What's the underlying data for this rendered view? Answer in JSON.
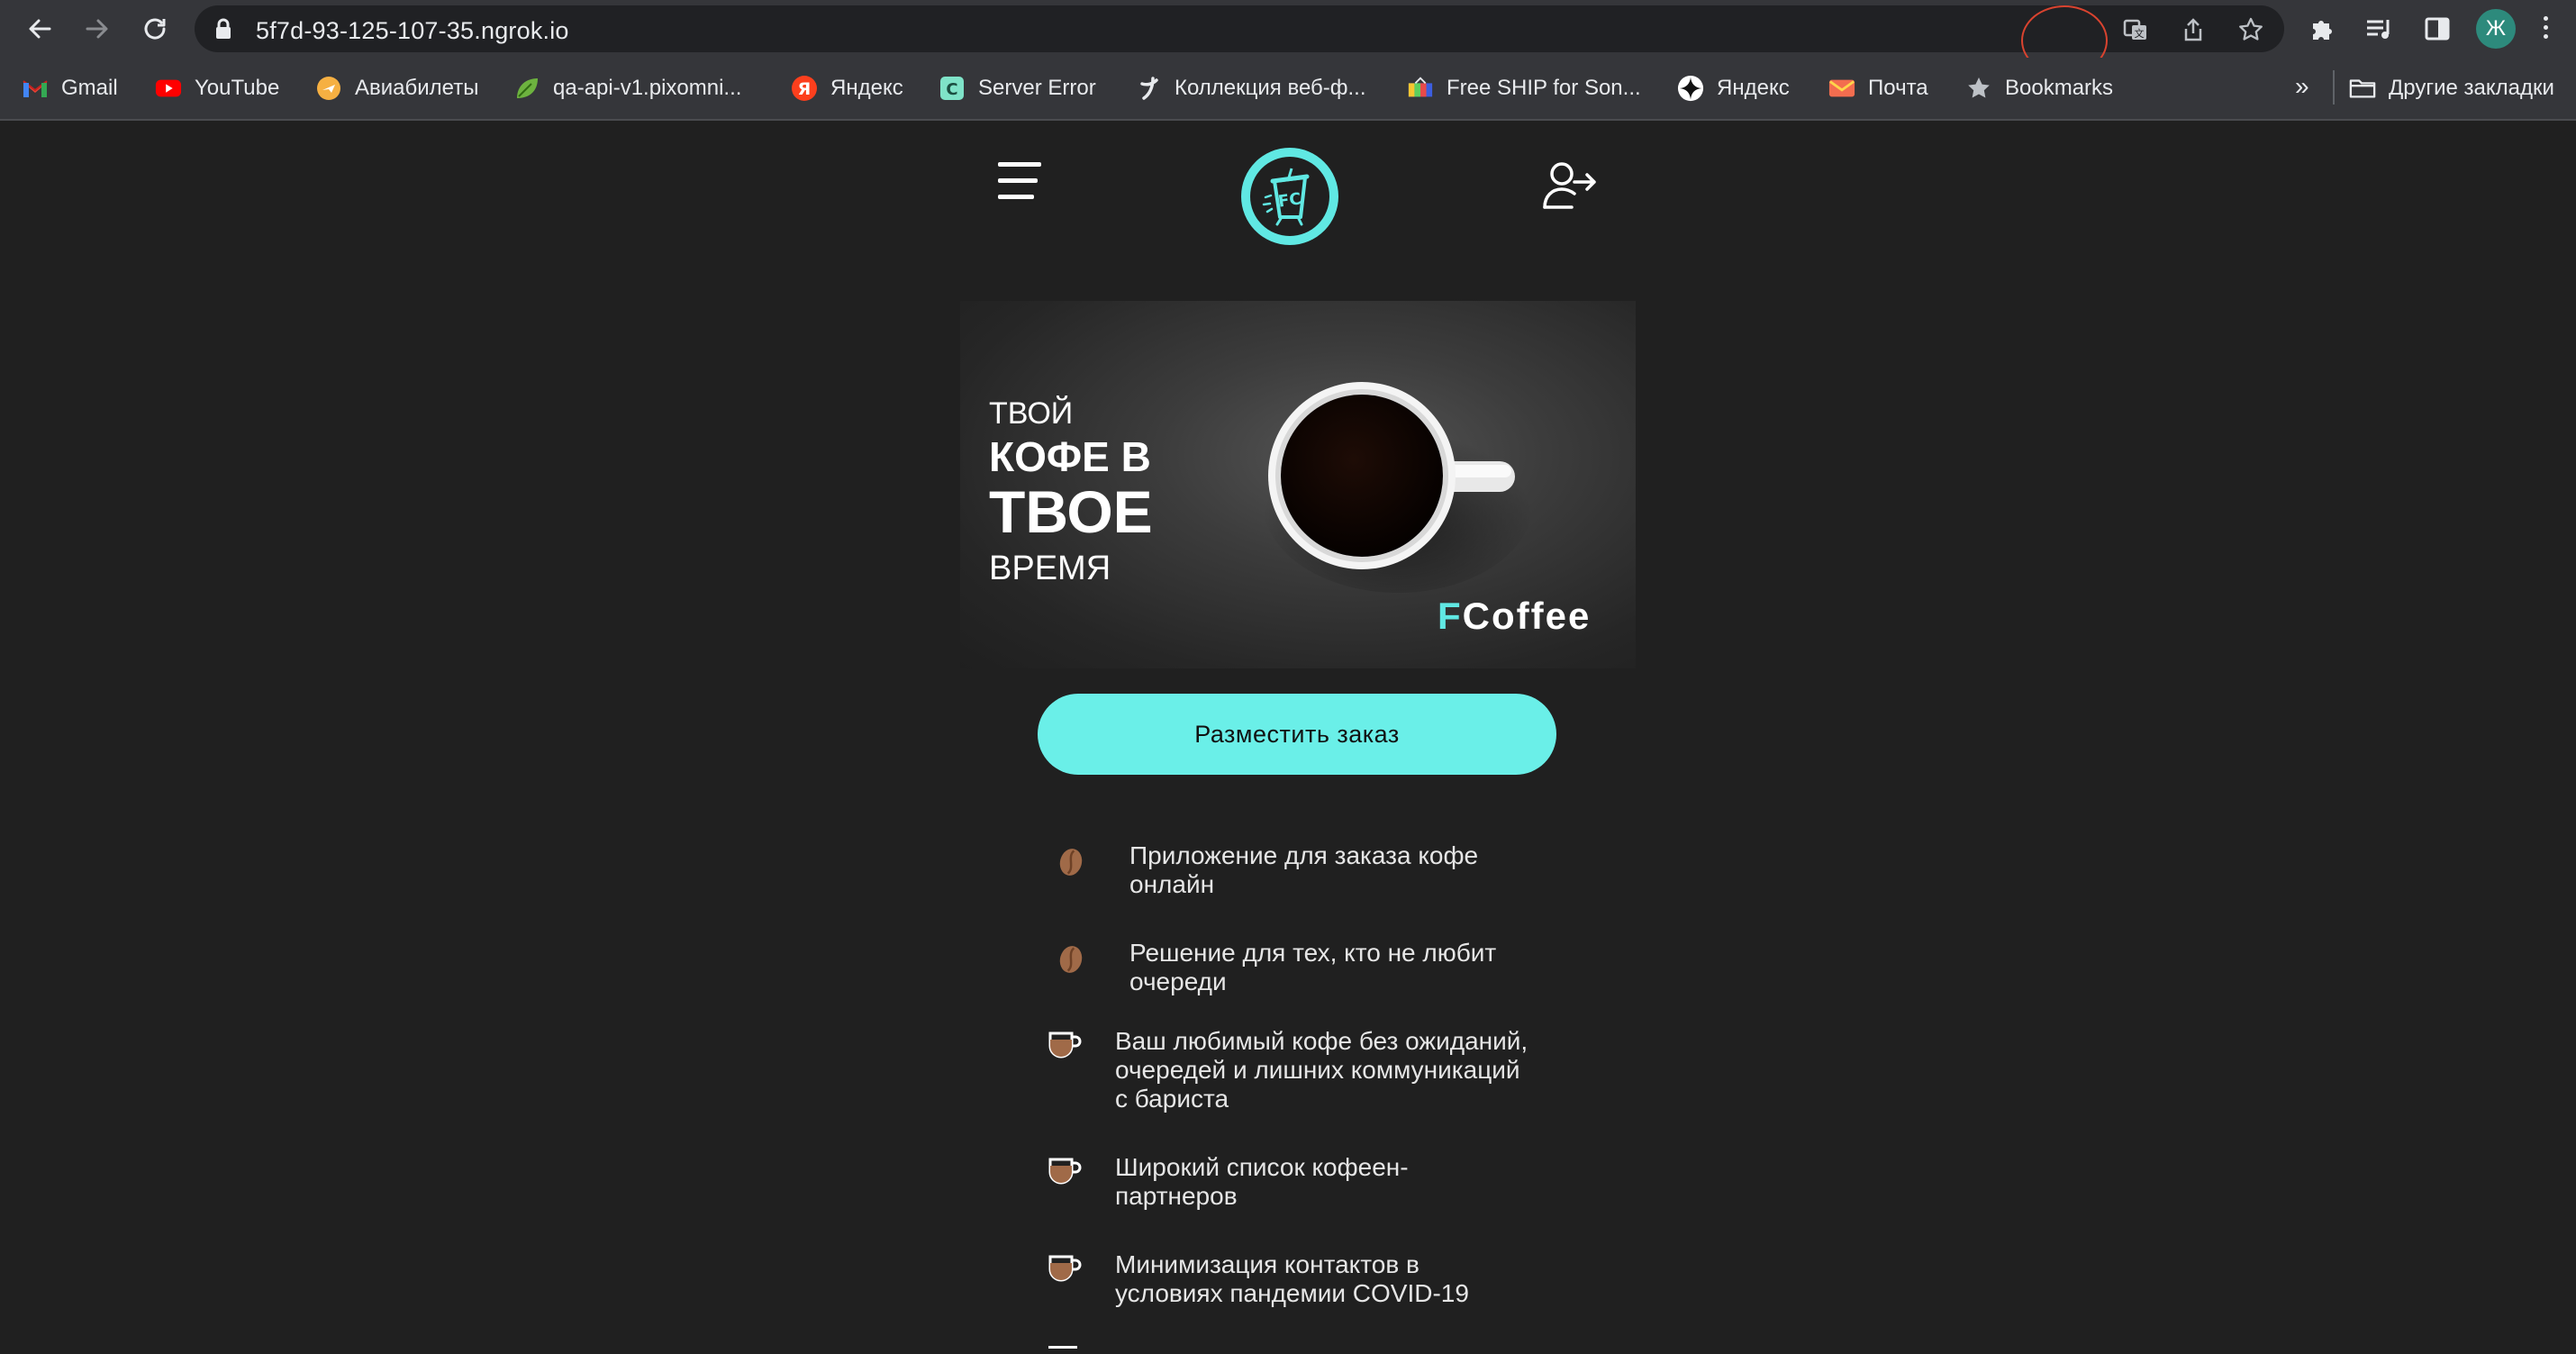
{
  "browser": {
    "url": "5f7d-93-125-107-35.ngrok.io",
    "profile_initial": "Ж",
    "bookmarks": [
      {
        "label": "Gmail",
        "icon": "gmail-icon"
      },
      {
        "label": "YouTube",
        "icon": "youtube-icon"
      },
      {
        "label": "Авиабилеты",
        "icon": "flights-icon"
      },
      {
        "label": "qa-api-v1.pixomni...",
        "icon": "leaf-icon"
      },
      {
        "label": "Яндекс",
        "icon": "yandex-icon"
      },
      {
        "label": "Server Error",
        "icon": "server-icon"
      },
      {
        "label": "Коллекция веб-ф...",
        "icon": "font-collection-icon"
      },
      {
        "label": "Free SHIP for Son...",
        "icon": "ship-icon"
      },
      {
        "label": "Яндекс",
        "icon": "yandex-star-icon"
      },
      {
        "label": "Почта",
        "icon": "mail-icon"
      },
      {
        "label": "Bookmarks",
        "icon": "star-icon"
      }
    ],
    "more_label": "»",
    "other_bookmarks_label": "Другие закладки"
  },
  "hero": {
    "line1": "ТВОЙ",
    "line2": "КОФЕ В",
    "line3": "ТВОЕ",
    "line4": "ВРЕМЯ",
    "brand_first": "F",
    "brand_rest": "Coffee"
  },
  "order_button": "Разместить заказ",
  "features": [
    {
      "icon": "coffee-bean-icon",
      "lines": [
        "Приложение для заказа кофе",
        "онлайн"
      ]
    },
    {
      "icon": "coffee-bean-icon",
      "lines": [
        "Решение для тех, кто не любит",
        "очереди"
      ]
    },
    {
      "icon": "coffee-cup-icon",
      "lines": [
        "Ваш любимый кофе без ожиданий,",
        "очередей и лишних коммуникаций",
        "с бариста"
      ]
    },
    {
      "icon": "coffee-cup-icon",
      "lines": [
        "Широкий список кофеен-",
        "партнеров"
      ]
    },
    {
      "icon": "coffee-cup-icon",
      "lines": [
        "Минимизация контактов в",
        "условиях пандемии COVID-19"
      ]
    }
  ],
  "colors": {
    "accent": "#6aefe8",
    "background": "#202020",
    "bean": "#a06a48"
  }
}
